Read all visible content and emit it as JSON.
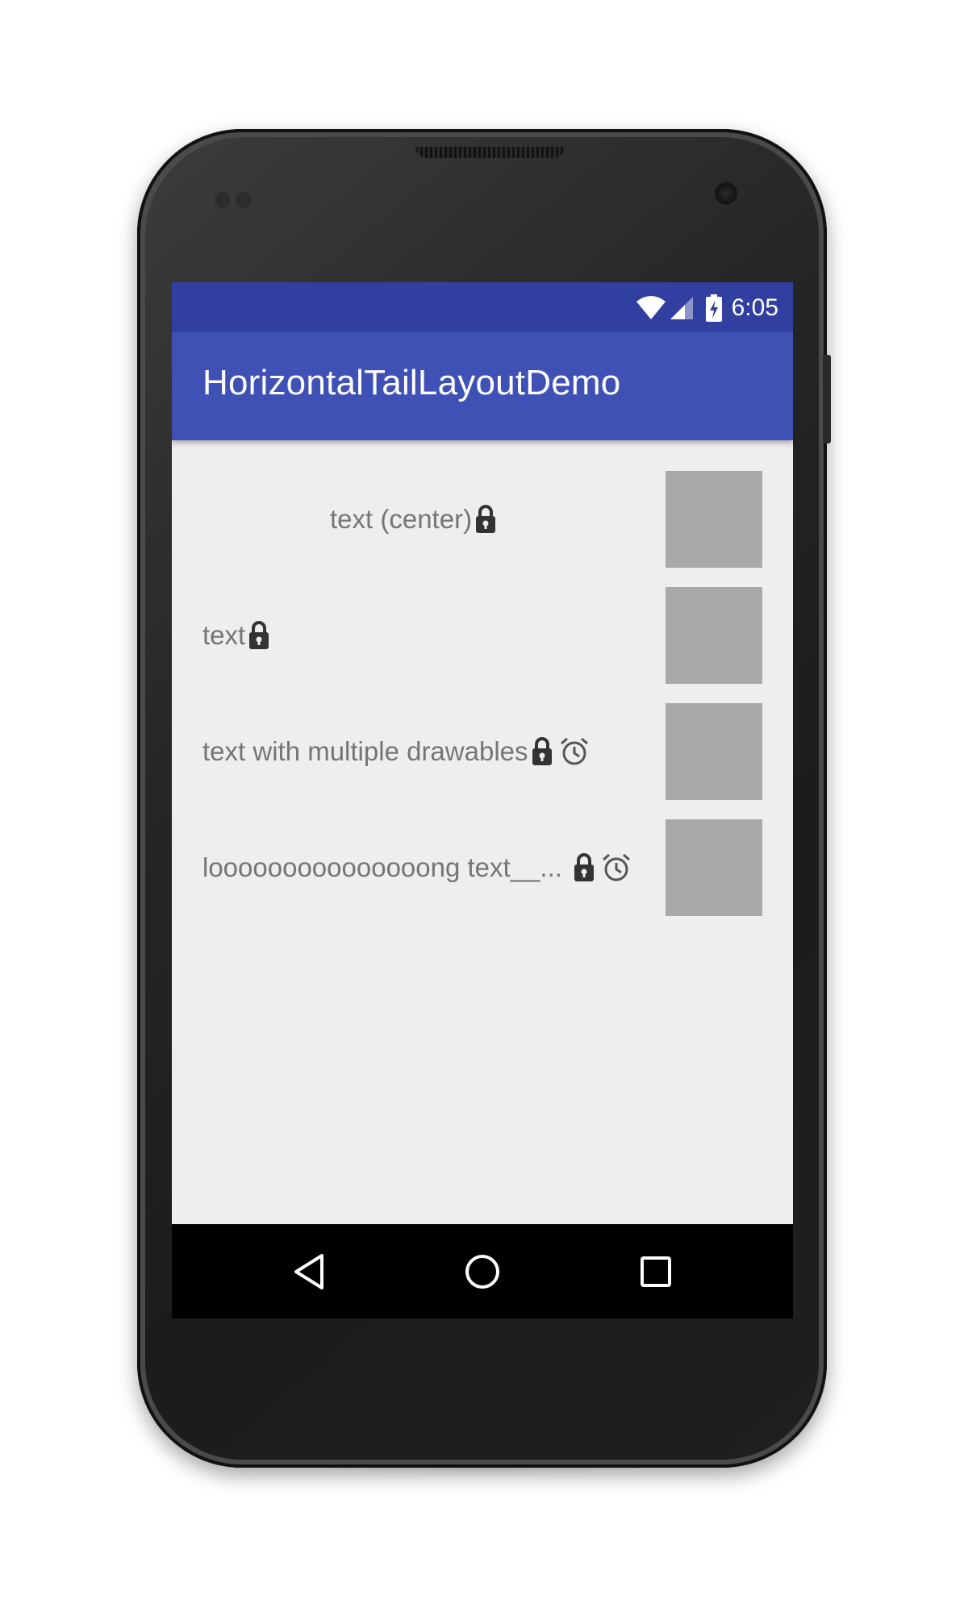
{
  "status_bar": {
    "time": "6:05"
  },
  "app_bar": {
    "title": "HorizontalTailLayoutDemo"
  },
  "rows": [
    {
      "text": "text (center)",
      "icons": [
        "lock-icon"
      ]
    },
    {
      "text": "text",
      "icons": [
        "lock-icon"
      ]
    },
    {
      "text": "text with multiple drawables",
      "icons": [
        "lock-icon",
        "alarm-icon"
      ]
    },
    {
      "text": "looooooooooooooong text__...",
      "icons": [
        "lock-icon",
        "alarm-icon"
      ]
    }
  ],
  "nav_bar": {
    "buttons": [
      "back-icon",
      "home-icon",
      "recents-icon"
    ]
  },
  "colors": {
    "status_bar": "#3140a0",
    "app_bar": "#3f51b5",
    "background": "#eeeeee",
    "text": "#757575",
    "thumbnail": "#a9a9a9"
  }
}
